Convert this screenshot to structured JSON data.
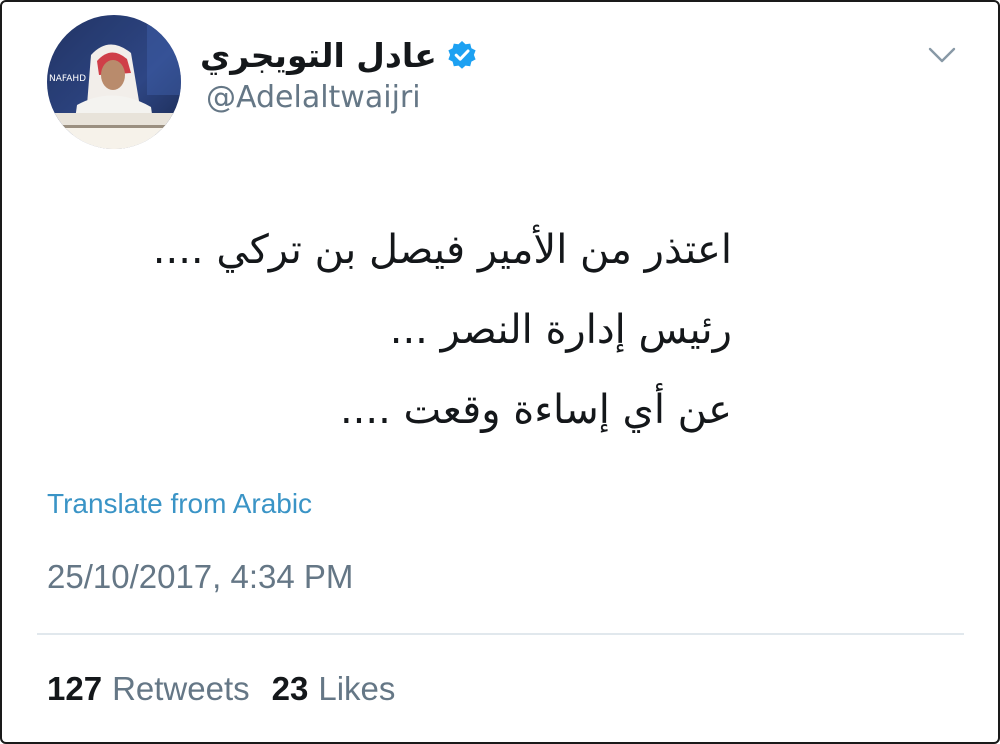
{
  "tweet": {
    "author": {
      "display_name": "عادل التويجري",
      "handle": "@Adelaltwaijri",
      "verified": true,
      "avatar_icon": "profile-photo",
      "avatar_caption": "NAFAHD"
    },
    "menu_icon": "chevron-down-icon",
    "text_lines": [
      "اعتذر من الأمير فيصل بن تركي ....",
      "رئيس إدارة النصر ...",
      "عن أي إساءة وقعت ...."
    ],
    "translate_label": "Translate from Arabic",
    "timestamp": "25/10/2017, 4:34 PM",
    "stats": {
      "retweets_count": "127",
      "retweets_label": "Retweets",
      "likes_count": "23",
      "likes_label": "Likes"
    }
  },
  "colors": {
    "text_primary": "#14171a",
    "text_secondary": "#657786",
    "link": "#3a94c6",
    "verified_badge": "#1da1f2",
    "divider": "#e1e8ed"
  }
}
